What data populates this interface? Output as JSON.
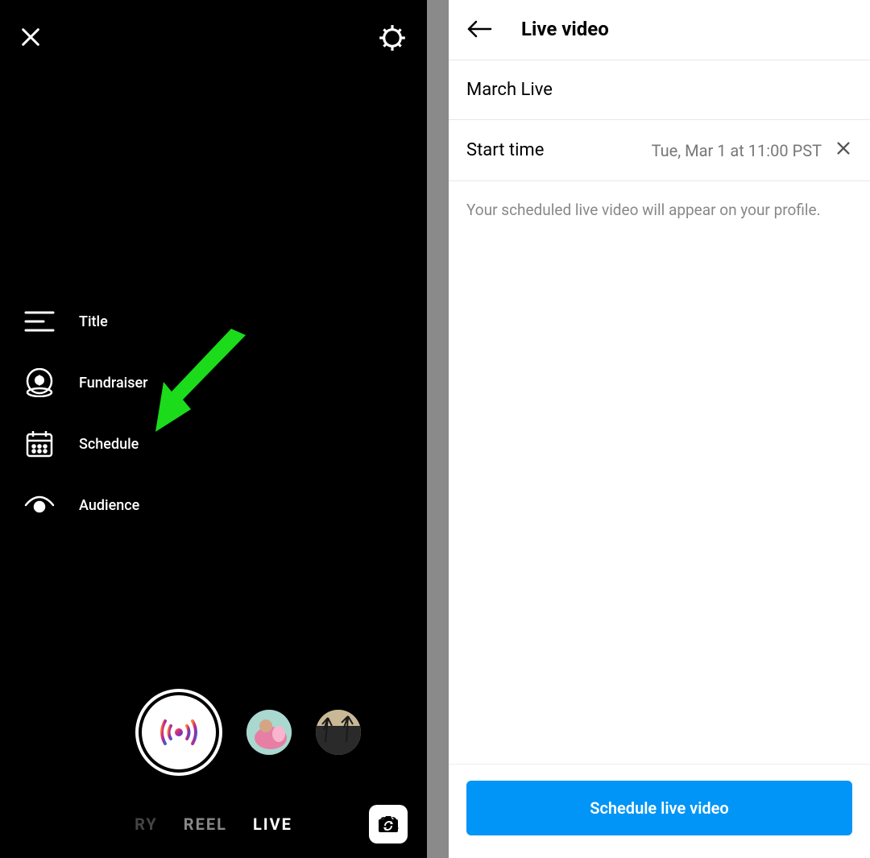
{
  "left": {
    "options": {
      "title": "Title",
      "fundraiser": "Fundraiser",
      "schedule": "Schedule",
      "audience": "Audience"
    },
    "modes": {
      "story": "RY",
      "reel": "REEL",
      "live": "LIVE"
    }
  },
  "right": {
    "header_title": "Live video",
    "live_name": "March Live",
    "start_time_label": "Start time",
    "start_time_value": "Tue, Mar 1 at 11:00 PST",
    "info": "Your scheduled live video will appear on your profile.",
    "button": "Schedule live video"
  },
  "annotation": {
    "arrow_color": "#1bdb1b"
  }
}
